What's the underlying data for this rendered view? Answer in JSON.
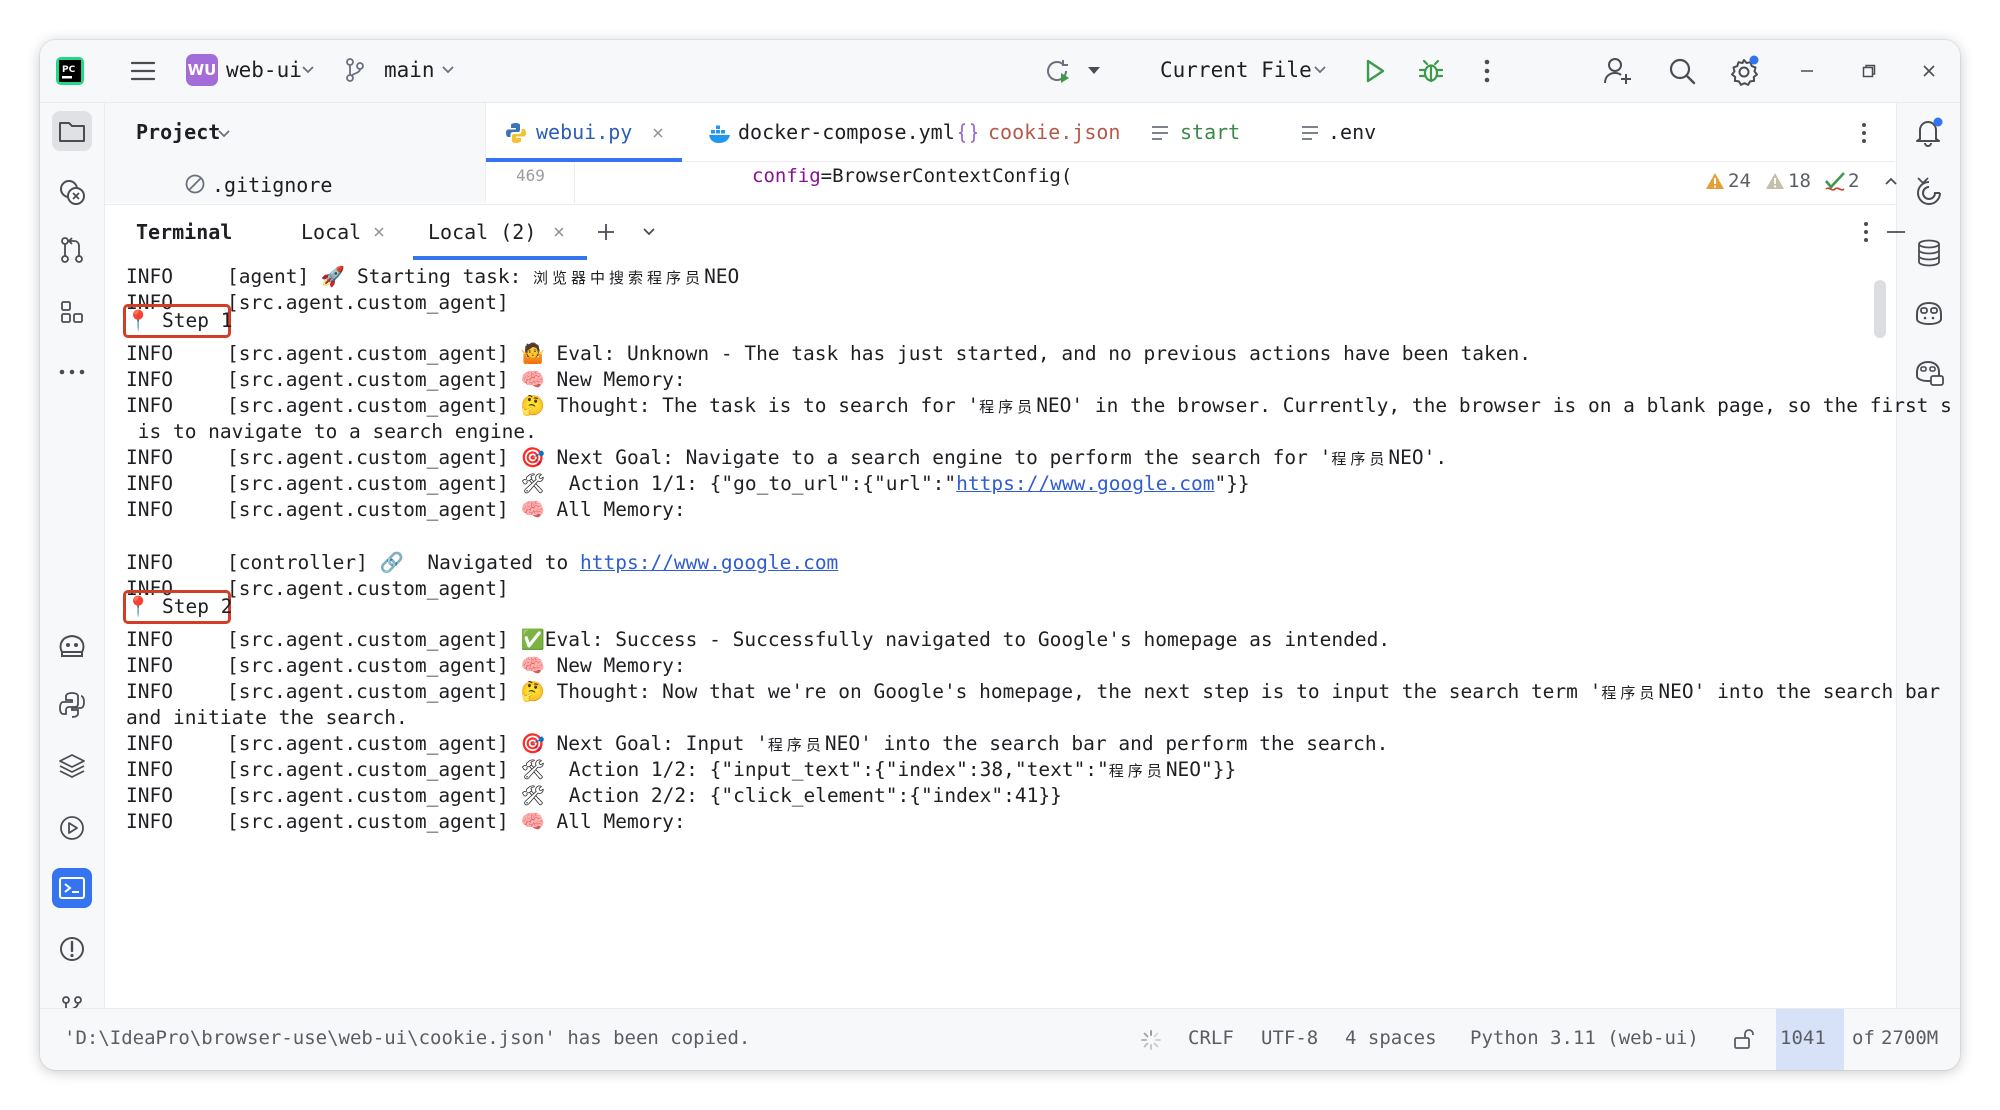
{
  "topbar": {
    "project_badge": "WU",
    "project_name": "web-ui",
    "branch": "main",
    "run_config": "Current File"
  },
  "project_panel": {
    "title": "Project",
    "file": ".gitignore"
  },
  "editor_tabs": [
    {
      "label": "webui.py",
      "active": true
    },
    {
      "label": "docker-compose.yml",
      "active": false
    },
    {
      "label": "cookie.json",
      "active": false
    },
    {
      "label": "start",
      "active": false
    },
    {
      "label": ".env",
      "active": false
    }
  ],
  "editor": {
    "line_number": "469",
    "code_key": "config",
    "code_rest": "=BrowserContextConfig(",
    "inspections": {
      "warnings": "24",
      "weak_warnings": "18",
      "typos": "2"
    }
  },
  "terminal": {
    "title": "Terminal",
    "tabs": [
      "Local",
      "Local (2)"
    ],
    "lines": {
      "l1_level": "INFO",
      "l1_src": "[agent] ",
      "l1_text": " Starting task: ",
      "l1_cjk": "浏览器中搜索程序员",
      "l1_tail": "NEO",
      "l2_level": "INFO",
      "l2_src": "[src.agent.custom_agent]",
      "step1": "Step 1",
      "l3_level": "INFO",
      "l3_src": "[src.agent.custom_agent] ",
      "l3_text": " Eval: Unknown - The task has just started, and no previous actions have been taken.",
      "l4_level": "INFO",
      "l4_src": "[src.agent.custom_agent] ",
      "l4_text": " New Memory:",
      "l5_level": "INFO",
      "l5_src": "[src.agent.custom_agent] ",
      "l5_text": " Thought: The task is to search for '",
      "l5_cjk": "程序员",
      "l5_tail": "NEO' in the browser. Currently, the browser is on a blank page, so the first s",
      "l5_wrap": " is to navigate to a search engine.",
      "l6_level": "INFO",
      "l6_src": "[src.agent.custom_agent] ",
      "l6_text": " Next Goal: Navigate to a search engine to perform the search for '",
      "l6_cjk": "程序员",
      "l6_tail": "NEO'.",
      "l7_level": "INFO",
      "l7_src": "[src.agent.custom_agent] ",
      "l7_text": "  Action 1/1: {\"go_to_url\":{\"url\":\"",
      "l7_link": "https://www.google.com",
      "l7_tail": "\"}}",
      "l8_level": "INFO",
      "l8_src": "[src.agent.custom_agent] ",
      "l8_text": " All Memory:",
      "l9_level": "INFO",
      "l9_src": "[controller] ",
      "l9_text": "  Navigated to ",
      "l9_link": "https://www.google.com",
      "l10_level": "INFO",
      "l10_src": "[src.agent.custom_agent]",
      "step2": "Step 2",
      "l11_level": "INFO",
      "l11_src": "[src.agent.custom_agent] ",
      "l11_text": "Eval: Success - Successfully navigated to Google's homepage as intended.",
      "l12_level": "INFO",
      "l12_src": "[src.agent.custom_agent] ",
      "l12_text": " New Memory:",
      "l13_level": "INFO",
      "l13_src": "[src.agent.custom_agent] ",
      "l13_text": " Thought: Now that we're on Google's homepage, the next step is to input the search term '",
      "l13_cjk": "程序员",
      "l13_tail": "NEO' into the search bar",
      "l13_wrap": "and initiate the search.",
      "l14_level": "INFO",
      "l14_src": "[src.agent.custom_agent] ",
      "l14_text": " Next Goal: Input '",
      "l14_cjk": "程序员",
      "l14_tail": "NEO' into the search bar and perform the search.",
      "l15_level": "INFO",
      "l15_src": "[src.agent.custom_agent] ",
      "l15_text": "  Action 1/2: {\"input_text\":{\"index\":38,\"text\":\"",
      "l15_cjk": "程序员",
      "l15_tail": "NEO\"}}",
      "l16_level": "INFO",
      "l16_src": "[src.agent.custom_agent] ",
      "l16_text": "  Action 2/2: {\"click_element\":{\"index\":41}}",
      "l17_level": "INFO",
      "l17_src": "[src.agent.custom_agent] ",
      "l17_text": " All Memory:"
    }
  },
  "statusbar": {
    "message": "'D:\\IdeaPro\\browser-use\\web-ui\\cookie.json' has been copied.",
    "line_sep": "CRLF",
    "encoding": "UTF-8",
    "indent": "4 spaces",
    "interpreter": "Python 3.11 (web-ui)",
    "mem_used": "1041",
    "mem_of": "of",
    "mem_total": "2700M"
  },
  "colors": {
    "accent": "#3574f0",
    "step_box": "#d13e26",
    "link": "#2f5cd0",
    "run_green": "#3c9a4a"
  }
}
